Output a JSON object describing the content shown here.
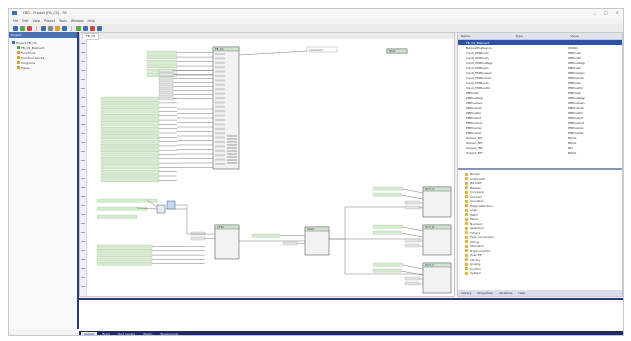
{
  "window": {
    "title": "FBD - Project [FB_CS] - FB",
    "controls": [
      "_",
      "□",
      "×"
    ]
  },
  "menu": [
    "File",
    "Edit",
    "View",
    "Project",
    "Tools",
    "Window",
    "Help"
  ],
  "toolbar": {
    "colors": [
      "#3b6db3",
      "#5fa34a",
      "#c94a4a",
      "#3b6db3",
      "#888888",
      "#d8a430",
      "#3b6db3",
      "#5fa34a",
      "#3b6db3",
      "#c94a4a",
      "#3b6db3"
    ]
  },
  "project_panel": {
    "title": "Project",
    "items": [
      {
        "label": "Project FB_CS",
        "color": "#3b6db3",
        "indent": 0
      },
      {
        "label": "FB_CS_Element",
        "color": "#5fa34a",
        "indent": 1
      },
      {
        "label": "Functions",
        "color": "#d8a430",
        "indent": 1
      },
      {
        "label": "Function blocks",
        "color": "#d8a430",
        "indent": 1
      },
      {
        "label": "Programs",
        "color": "#d8a430",
        "indent": 1
      },
      {
        "label": "Types",
        "color": "#d8a430",
        "indent": 1
      }
    ]
  },
  "editor": {
    "tab_label": "FB_CS",
    "block_headers": [
      "FB_CS",
      "CTRL",
      "CALC",
      "MOV",
      "OUT_A",
      "OUT_B",
      "OUT_C"
    ],
    "annotation": "Comment"
  },
  "properties": {
    "columns": [
      "Name",
      "Type",
      "Value"
    ],
    "header_row": "FB_CS_Element",
    "rows": [
      [
        "NameOfCategory",
        "WORD"
      ],
      [
        "Input_PMPlusIn",
        "PMPlusIn"
      ],
      [
        "Input_PMPlusIn",
        "PMPlusIn"
      ],
      [
        "Input_PMPlusRegr",
        "PMPlusRegr"
      ],
      [
        "Input_PMPlusIn",
        "PMPlusIn"
      ],
      [
        "Input_PMPlusGen",
        "PMPlusGen"
      ],
      [
        "Input_PMPlusCat",
        "PMPlusCat"
      ],
      [
        "Input_PMPlusIn",
        "PMPlusIn"
      ],
      [
        "Input_PMPlusPol",
        "PMPlusPol"
      ],
      [
        "PMPlusIn",
        "PMPlusIn"
      ],
      [
        "PMPlusRegr",
        "PMPlusRegr"
      ],
      [
        "PMPlusGen",
        "PMPlusGen"
      ],
      [
        "PMPlusCat",
        "PMPlusCat"
      ],
      [
        "PMPlusPol",
        "PMPlusPol"
      ],
      [
        "PMPlusInit",
        "PMPlusInit"
      ],
      [
        "PMPlusOut",
        "PMPlusOut"
      ],
      [
        "PMPlusCal",
        "PMPlusCal"
      ],
      [
        "PMPlusSet",
        "PMPlusSet"
      ],
      [
        "Output_BIT",
        "BOOL"
      ],
      [
        "Output_BIT",
        "BOOL"
      ],
      [
        "Output_INT",
        "INT"
      ],
      [
        "Output_BIT",
        "BOOL"
      ]
    ]
  },
  "library": {
    "items": [
      "Blocks",
      "Arithmetic",
      "Bit shift",
      "Bitwise",
      "Compare",
      "Convert",
      "Counters",
      "Edge detection",
      "Logic",
      "Math",
      "Move",
      "Numeric",
      "Selection",
      "Timers",
      "Type conversion",
      "String",
      "Standard",
      "Trigonometric",
      "User FB",
      "Library",
      "Analog",
      "Control",
      "System"
    ],
    "tabs": [
      "Library",
      "Properties",
      "Variables",
      "Help"
    ]
  },
  "output": {
    "tabs": [
      "Output",
      "Build",
      "Find results",
      "Watch",
      "Breakpoints"
    ]
  }
}
